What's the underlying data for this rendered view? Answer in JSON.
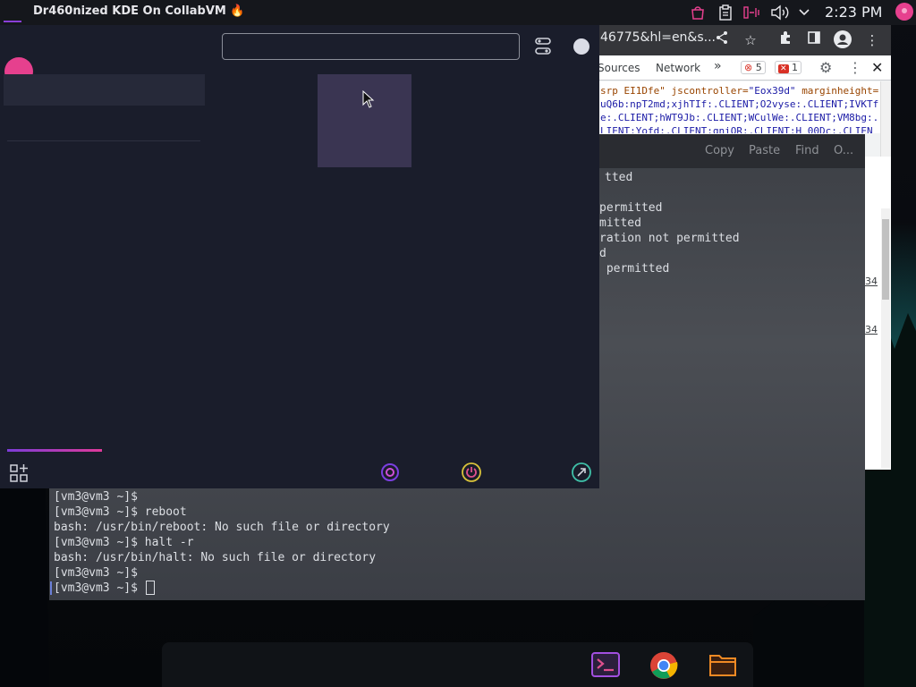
{
  "panel": {
    "title": "Dr460nized KDE On CollabVM",
    "title_icon": "fire-icon",
    "tray_icons": [
      "bag-icon",
      "clipboard-icon",
      "mic-muted-icon",
      "volume-icon",
      "chevron-down-icon"
    ],
    "clock": "2:23 PM",
    "accent_color": "#e6408e"
  },
  "chrome": {
    "url": "46775&hl=en&s...",
    "devtools_tabs": [
      "Sources",
      "Network"
    ],
    "more_tabs": "»",
    "error_count": "5",
    "warning_count": "1",
    "code_lines": [
      {
        "a": "srp EI1Dfe\" ",
        "b": "jscontroller=",
        "c": "\"Eox39d\" ",
        "d": "marginheight="
      },
      {
        "a": "",
        "b": "",
        "c": "uQ6b:npT2md;xjhTIf:.CLIENT;O2vyse:.CLIENT;IVKTf",
        "d": ""
      },
      {
        "a": "",
        "b": "",
        "c": "e:.CLIENT;hWT9Jb:.CLIENT;WCulWe:.CLIENT;VM8bg:.",
        "d": ""
      },
      {
        "a": "",
        "b": "",
        "c": "LIENT;Yofd:.CLIENT;qniOR:.CLIENT;H_00Dc:.CLIEN",
        "d": ""
      }
    ],
    "line_numbers": [
      "34",
      "34"
    ]
  },
  "konsole": {
    "toolbar": [
      "Copy",
      "Paste",
      "Find",
      "O..."
    ],
    "partial_lines": [
      "tted",
      "",
      "permitted",
      "mitted",
      "ration not permitted",
      "d",
      " permitted"
    ],
    "lines": [
      "[vm3@vm3 ~]$",
      "[vm3@vm3 ~]$ reboot",
      "bash: /usr/bin/reboot: No such file or directory",
      "[vm3@vm3 ~]$ halt -r",
      "bash: /usr/bin/halt: No such file or directory",
      "[vm3@vm3 ~]$",
      "[vm3@vm3 ~]$ "
    ]
  },
  "launcher": {
    "search_value": "",
    "search_placeholder": "",
    "bottom_buttons": [
      "apps-grid-icon",
      "lock-icon",
      "power-icon",
      "leave-icon"
    ]
  },
  "dock": {
    "apps": [
      "konsole",
      "chrome",
      "file-manager"
    ]
  }
}
